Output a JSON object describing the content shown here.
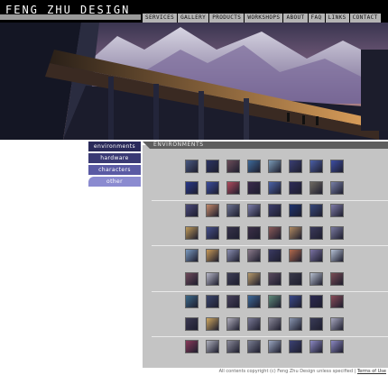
{
  "site": {
    "logo": "FENG ZHU DESIGN"
  },
  "nav": [
    "SERVICES",
    "GALLERY",
    "PRODUCTS",
    "WORKSHOPS",
    "ABOUT",
    "FAQ",
    "LINKS",
    "CONTACT"
  ],
  "sidebar": {
    "items": [
      {
        "label": "environments",
        "active": true
      },
      {
        "label": "hardware",
        "active": false
      },
      {
        "label": "characters",
        "active": false
      },
      {
        "label": "other",
        "active": false
      }
    ]
  },
  "gallery": {
    "title": "ENVIRONMENTS",
    "thumbnail_rows": [
      [
        "#4a5a82",
        "#2c3464",
        "#6c4e5a",
        "#3e6a9a",
        "#7a9ab6",
        "#3a3f74",
        "#4b5fa6",
        "#3d4ea4"
      ],
      [
        "#27378a",
        "#3a4c9e",
        "#b04a5c",
        "#3a2a4c",
        "#4a63a8",
        "#2e2c58",
        "#6f6a62",
        "#7880a8"
      ],
      [
        "#4b4a7a",
        "#c48a6a",
        "#6c7290",
        "#7c7eaa",
        "#3c3e6c",
        "#1e3470",
        "#37487c",
        "#7f7ca8"
      ],
      [
        "#bf9a5a",
        "#45508a",
        "#36324a",
        "#3c3048",
        "#8a5a58",
        "#b08a62",
        "#3b3a5c",
        "#7a7aa0"
      ],
      [
        "#7a9ac0",
        "#c89a58",
        "#8a8eb0",
        "#8a7a8a",
        "#3a3a62",
        "#b26a4c",
        "#7a72a2",
        "#b6c2d6"
      ],
      [
        "#6e4a5a",
        "#b8b8c8",
        "#3e3e56",
        "#b89a6a",
        "#5a4a5e",
        "#3a3a4a",
        "#b8c0d0",
        "#7a4c54"
      ],
      [
        "#3c6a8a",
        "#3a466c",
        "#48425c",
        "#3d6a9a",
        "#5f8a7a",
        "#3a4a8a",
        "#2c2a52",
        "#8a4c58"
      ],
      [
        "#3c3a52",
        "#d0a860",
        "#b0aebc",
        "#7a7a96",
        "#8a8898",
        "#8a96b0",
        "#3a3c58",
        "#a8a8c0"
      ],
      [
        "#8a3a5a",
        "#aeb0bc",
        "#8a8a9a",
        "#7a7e92",
        "#9aa6c0",
        "#3c4274",
        "#8b88c2",
        "#8b88c2"
      ]
    ]
  },
  "footer": {
    "copyright": "All contents copyright (c) Feng Zhu Design unless specified  |",
    "terms": "Terms of Use"
  }
}
